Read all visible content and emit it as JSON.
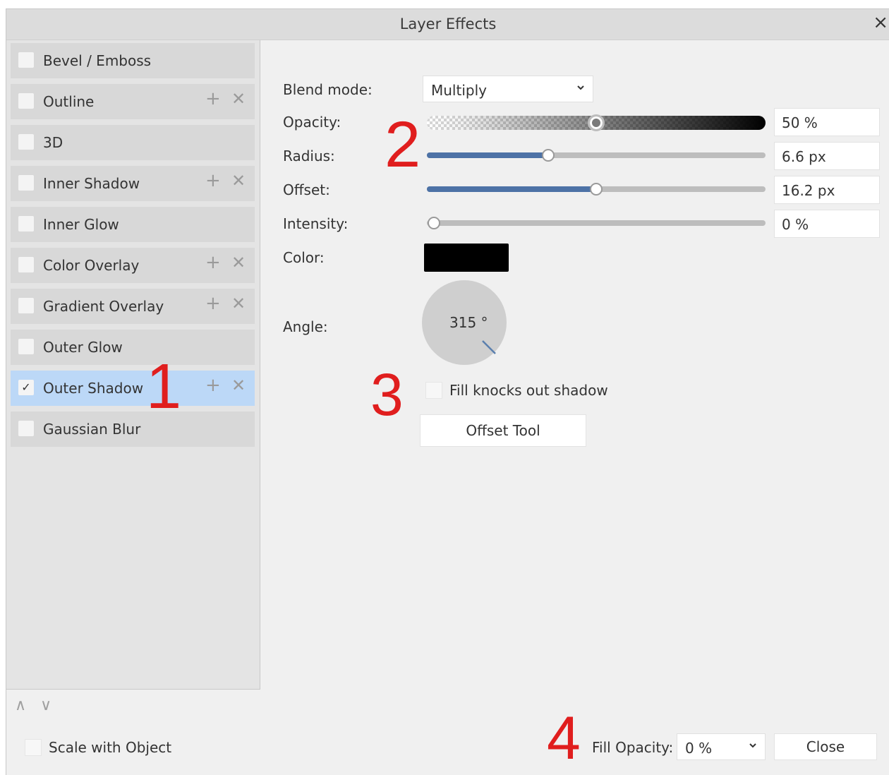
{
  "window": {
    "title": "Layer Effects",
    "close_glyph": "×"
  },
  "effects": [
    {
      "label": "Bevel / Emboss",
      "checked": false,
      "selected": false,
      "has_actions": false
    },
    {
      "label": "Outline",
      "checked": false,
      "selected": false,
      "has_actions": true
    },
    {
      "label": "3D",
      "checked": false,
      "selected": false,
      "has_actions": false
    },
    {
      "label": "Inner Shadow",
      "checked": false,
      "selected": false,
      "has_actions": true
    },
    {
      "label": "Inner Glow",
      "checked": false,
      "selected": false,
      "has_actions": false
    },
    {
      "label": "Color Overlay",
      "checked": false,
      "selected": false,
      "has_actions": true
    },
    {
      "label": "Gradient Overlay",
      "checked": false,
      "selected": false,
      "has_actions": true
    },
    {
      "label": "Outer Glow",
      "checked": false,
      "selected": false,
      "has_actions": false
    },
    {
      "label": "Outer Shadow",
      "checked": true,
      "selected": true,
      "has_actions": true
    },
    {
      "label": "Gaussian Blur",
      "checked": false,
      "selected": false,
      "has_actions": false
    }
  ],
  "properties": {
    "blend_mode": {
      "label": "Blend mode:",
      "value": "Multiply"
    },
    "opacity": {
      "label": "Opacity:",
      "value": "50 %",
      "level": 0.5
    },
    "radius": {
      "label": "Radius:",
      "value": "6.6 px",
      "level": 0.36
    },
    "offset": {
      "label": "Offset:",
      "value": "16.2 px",
      "level": 0.5
    },
    "intensity": {
      "label": "Intensity:",
      "value": "0 %",
      "level": 0.0
    },
    "color": {
      "label": "Color:",
      "swatch": "#000000"
    },
    "angle": {
      "label": "Angle:",
      "value": "315 °",
      "degrees": 315
    },
    "fill_knocks_out": {
      "label": "Fill knocks out shadow",
      "checked": false
    },
    "offset_tool": {
      "label": "Offset Tool"
    }
  },
  "footer": {
    "move_up_icon": "chevron-up-icon",
    "move_down_icon": "chevron-down-icon",
    "scale_with_object": {
      "label": "Scale with Object",
      "checked": false
    },
    "fill_opacity": {
      "label": "Fill Opacity:",
      "value": "0 %"
    },
    "close_button": "Close"
  },
  "annotations": [
    "1",
    "2",
    "3",
    "4"
  ],
  "colors": {
    "accent": "#4d72a6",
    "selected_row": "#bcd8f7",
    "annotation": "#e01e1e"
  }
}
